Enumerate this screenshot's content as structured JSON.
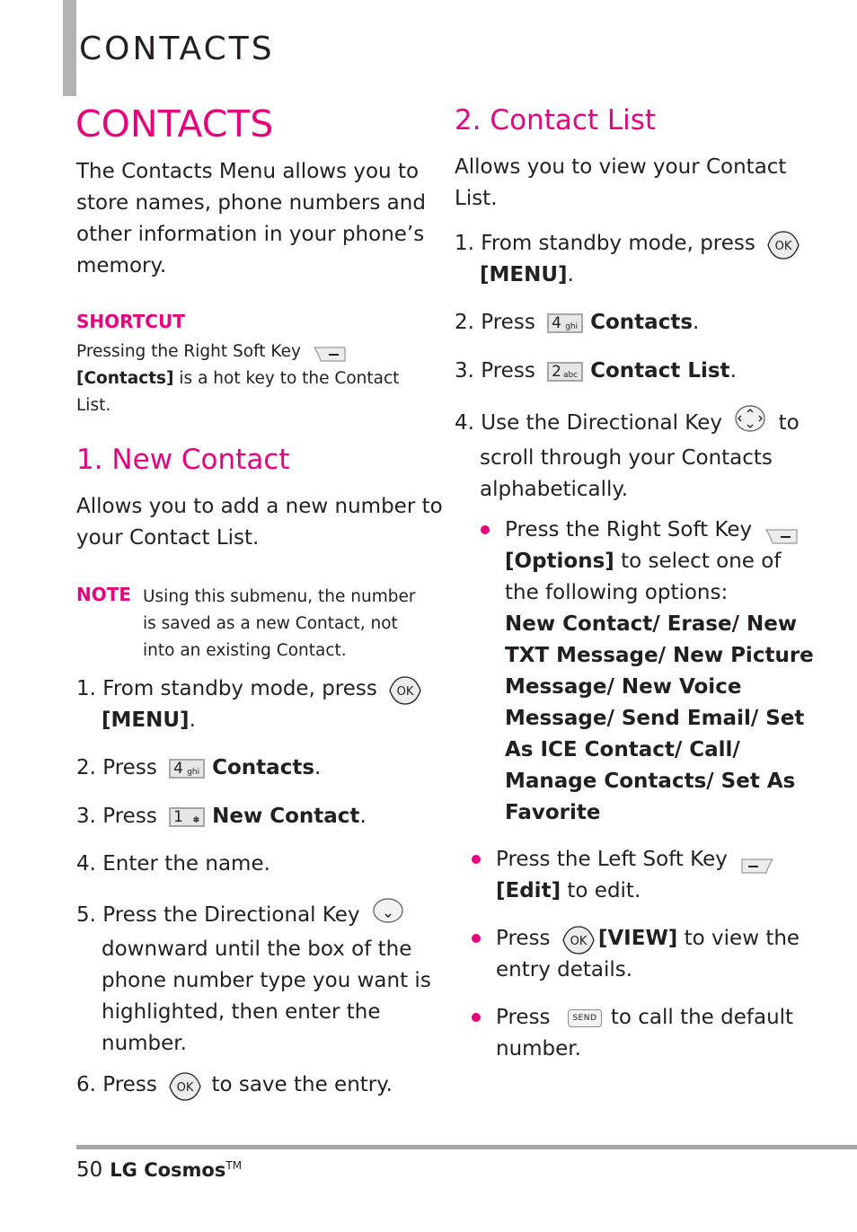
{
  "header": {
    "chapter_title": "CONTACTS"
  },
  "left": {
    "main_title": "CONTACTS",
    "intro": [
      "The Contacts Menu allows you to",
      "store names, phone numbers and",
      "other information in your phone’s",
      "memory."
    ],
    "shortcut": {
      "label": "SHORTCUT",
      "line1": "Pressing the Right Soft Key",
      "line2_bold": "[Contacts]",
      "line2_rest": " is a hot key to the Contact",
      "line3": "List."
    },
    "section1": {
      "title": "1. New Contact",
      "desc": [
        "Allows you to add a new number to",
        "your Contact List."
      ],
      "note": {
        "label": "NOTE",
        "lines": [
          "Using this submenu, the number",
          "is saved as a new Contact, not",
          "into an existing Contact."
        ]
      },
      "steps": [
        {
          "num": "1.",
          "text": "From standby mode, press",
          "icon": "ok-key",
          "line2": "[MENU]",
          "line2_end": "."
        },
        {
          "num": "2.",
          "text": "Press",
          "key_digit": "4",
          "key_sub": "ghi",
          "bold": "Contacts",
          "end": "."
        },
        {
          "num": "3.",
          "text": "Press",
          "key_digit": "1",
          "key_sub": "✽",
          "bold": "New Contact",
          "end": "."
        },
        {
          "num": "4.",
          "text": "Enter the name."
        },
        {
          "num": "5.",
          "text": "Press the Directional Key",
          "icon": "directional-down-key",
          "lines": [
            "downward until the box of the",
            "phone number type you want is",
            "highlighted, then enter the",
            "number."
          ]
        },
        {
          "num": "6.",
          "text": "Press",
          "icon": "ok-key",
          "rest": "to save the entry."
        }
      ]
    }
  },
  "right": {
    "section2": {
      "title": "2. Contact List",
      "desc": [
        "Allows you to view your Contact",
        "List."
      ],
      "steps": [
        {
          "num": "1.",
          "text": "From standby mode, press",
          "icon": "ok-key",
          "line2": "[MENU]",
          "line2_end": "."
        },
        {
          "num": "2.",
          "text": "Press",
          "key_digit": "4",
          "key_sub": "ghi",
          "bold": "Contacts",
          "end": "."
        },
        {
          "num": "3.",
          "text": "Press",
          "key_digit": "2",
          "key_sub": "abc",
          "bold": "Contact List",
          "end": "."
        },
        {
          "num": "4.",
          "text": "Use the Directional Key",
          "icon": "directional-key",
          "after": "to",
          "lines": [
            "scroll through your Contacts",
            "alphabetically."
          ]
        }
      ],
      "bullets": [
        {
          "text": "Press the Right Soft Key",
          "icon": "right-soft-key",
          "line2_bold": "[Options]",
          "line2_rest": " to select one of",
          "line3": "the following options:",
          "options_lines": [
            "New Contact/ Erase/ New",
            "TXT Message/ New Picture",
            "Message/ New Voice",
            "Message/ Send Email/ Set",
            "As ICE Contact/ Call/",
            "Manage Contacts/ Set As",
            "Favorite"
          ]
        },
        {
          "text": "Press the Left Soft Key",
          "icon": "left-soft-key",
          "line2_bold": "[Edit]",
          "line2_rest": " to edit."
        },
        {
          "text": "Press",
          "icon": "ok-key",
          "bold": "[VIEW]",
          "rest": " to view the",
          "line2": "entry details."
        },
        {
          "text": "Press",
          "icon": "send-key",
          "icon_label": "SEND",
          "rest": "to call the default",
          "line2": "number."
        }
      ]
    }
  },
  "footer": {
    "page_number": "50",
    "brand": "LG Cosmos",
    "trademark": "TM"
  },
  "colors": {
    "accent": "#e6007e",
    "text": "#231f20",
    "rule": "#a6a6a6",
    "sidebar": "#b3b3b3"
  }
}
